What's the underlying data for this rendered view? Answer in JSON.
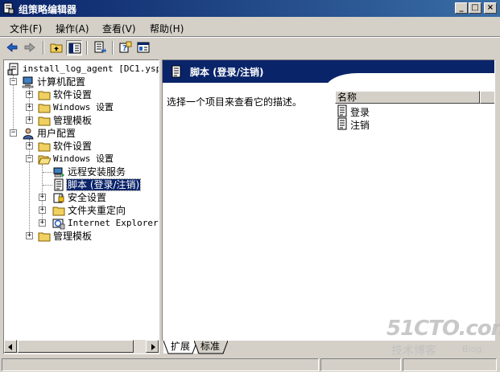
{
  "window": {
    "title": "组策略编辑器",
    "controls": {
      "minimize": "_",
      "maximize": "□",
      "close": "×"
    }
  },
  "menu": [
    {
      "label": "文件(F)"
    },
    {
      "label": "操作(A)"
    },
    {
      "label": "查看(V)"
    },
    {
      "label": "帮助(H)"
    }
  ],
  "toolbar": {
    "buttons": [
      "back-icon",
      "forward-icon",
      "up-folder-icon",
      "show-hide-tree-icon",
      "export-list-icon",
      "help-icon",
      "properties-icon"
    ]
  },
  "tree": {
    "root": "install_log_agent [DC1.yspla",
    "computer_config": "计算机配置",
    "cc_software": "软件设置",
    "cc_windows": "Windows 设置",
    "cc_admin": "管理模板",
    "user_config": "用户配置",
    "uc_software": "软件设置",
    "uc_windows": "Windows 设置",
    "ris": "远程安装服务",
    "scripts": "脚本 (登录/注销)",
    "security": "安全设置",
    "folder_redirect": "文件夹重定向",
    "ie": "Internet Explorer :",
    "uc_admin": "管理模板"
  },
  "right": {
    "header_title": "脚本 (登录/注销)",
    "description": "选择一个项目来查看它的描述。",
    "column_name": "名称",
    "items": [
      {
        "label": "登录"
      },
      {
        "label": "注销"
      }
    ]
  },
  "tabs": [
    {
      "label": "扩展",
      "active": true
    },
    {
      "label": "标准",
      "active": false
    }
  ],
  "watermark": {
    "main": "51CTO.com",
    "sub": "技术博客",
    "blog": "Blog"
  },
  "colors": {
    "title_bar": "#0a246a",
    "selection": "#0a246a",
    "face": "#d4d0c8",
    "folder": "#f0d060"
  }
}
